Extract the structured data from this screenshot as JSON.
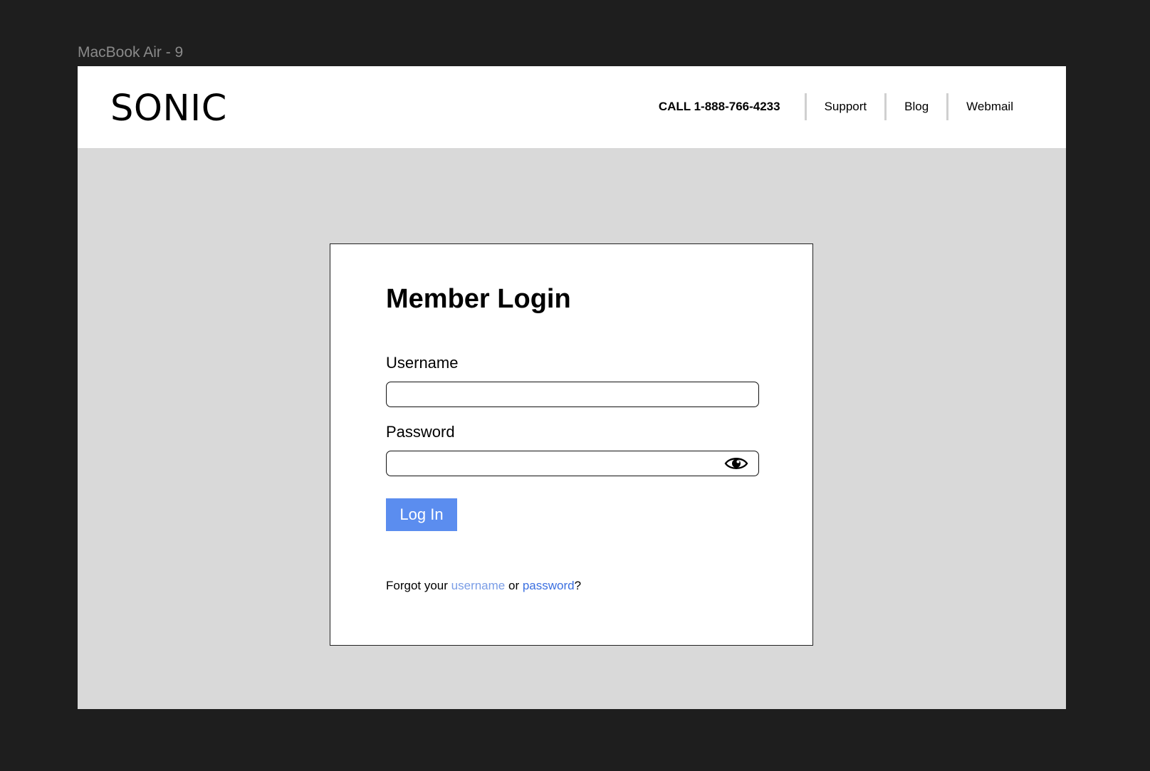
{
  "frame": {
    "label": "MacBook Air - 9"
  },
  "header": {
    "logo": "SONIC",
    "phone": "CALL 1-888-766-4233",
    "nav": [
      {
        "label": "Support"
      },
      {
        "label": "Blog"
      },
      {
        "label": "Webmail"
      }
    ]
  },
  "login": {
    "title": "Member Login",
    "username_label": "Username",
    "username_value": "",
    "password_label": "Password",
    "password_value": "",
    "show_password_icon": "eye-icon",
    "submit_label": "Log In",
    "forgot": {
      "prefix": "Forgot your ",
      "username_link": "username",
      "middle": " or ",
      "password_link": "password",
      "suffix": "?"
    }
  },
  "colors": {
    "page_background": "#1e1e1e",
    "frame_background": "#d9d9d9",
    "button": "#5b8def",
    "link_username": "#7a9de6",
    "link_password": "#3b6fe0"
  }
}
